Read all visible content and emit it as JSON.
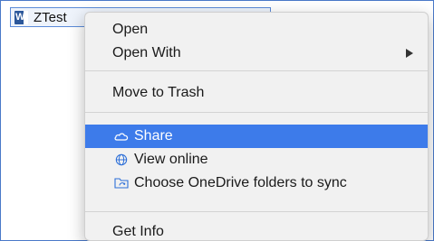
{
  "file": {
    "name": "ZTest",
    "icon": "word-document-icon"
  },
  "context_menu": {
    "items": [
      {
        "label": "Open"
      },
      {
        "label": "Open With"
      },
      {
        "label": "Move to Trash"
      },
      {
        "label": "Share",
        "icon": "onedrive-cloud-icon",
        "selected": true
      },
      {
        "label": "View online",
        "icon": "globe-icon"
      },
      {
        "label": "Choose OneDrive folders to sync",
        "icon": "folder-sync-icon"
      },
      {
        "label": "Get Info"
      }
    ]
  },
  "colors": {
    "highlight": "#3d7bea",
    "border": "#4a79c9"
  }
}
